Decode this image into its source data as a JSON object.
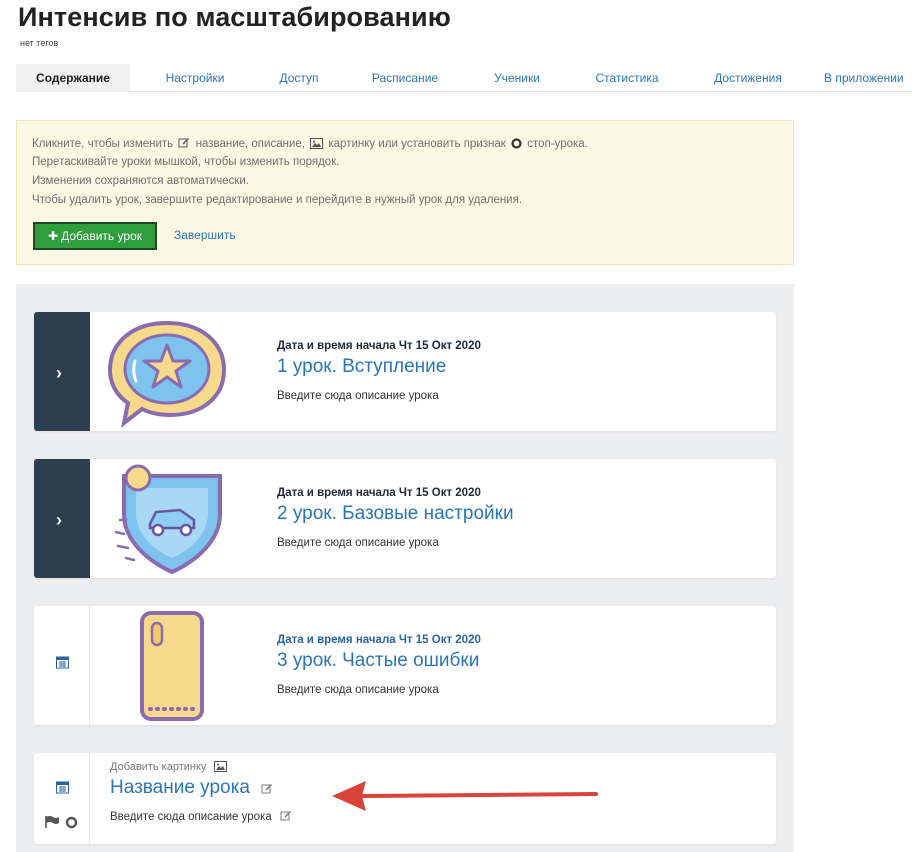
{
  "page": {
    "title": "Интенсив по масштабированию",
    "tags": "нет тегов"
  },
  "tabs": [
    {
      "label": "Содержание",
      "active": true
    },
    {
      "label": "Настройки"
    },
    {
      "label": "Доступ"
    },
    {
      "label": "Расписание"
    },
    {
      "label": "Ученики"
    },
    {
      "label": "Статистика"
    },
    {
      "label": "Достижения"
    },
    {
      "label": "В приложении"
    }
  ],
  "info": {
    "line1_a": "Кликните, чтобы изменить",
    "line1_b": "название, описание,",
    "line1_c": "картинку или установить признак",
    "line1_d": "стоп-урока.",
    "line2": "Перетаскивайте уроки мышкой, чтобы изменить порядок.",
    "line3": "Изменения сохраняются автоматически.",
    "line4": "Чтобы удалить урок, завершите редактирование и перейдите в нужный урок для удаления.",
    "add_button": "Добавить урок",
    "finish_link": "Завершить"
  },
  "lessons": [
    {
      "date": "Дата и время начала Чт 15 Окт 2020",
      "title": "1 урок. Вступление",
      "description": "Введите сюда описание урока",
      "icon": "chat-star-icon"
    },
    {
      "date": "Дата и время начала Чт 15 Окт 2020",
      "title": "2 урок. Базовые настройки",
      "description": "Введите сюда описание урока",
      "icon": "shield-car-icon"
    },
    {
      "date": "Дата и время начала Чт 15 Окт 2020",
      "title": "3 урок. Частые ошибки",
      "description": "Введите сюда описание урока",
      "icon": "phone-icon"
    }
  ],
  "new_lesson": {
    "add_image": "Добавить картинку",
    "title": "Название урока",
    "description": "Введите сюда описание урока"
  },
  "colors": {
    "accent": "#2a76b5",
    "green_button": "#2f9e3e",
    "dark_side": "#2d3e50",
    "info_bg": "#fcf8e3",
    "arrow": "#d9443a"
  }
}
